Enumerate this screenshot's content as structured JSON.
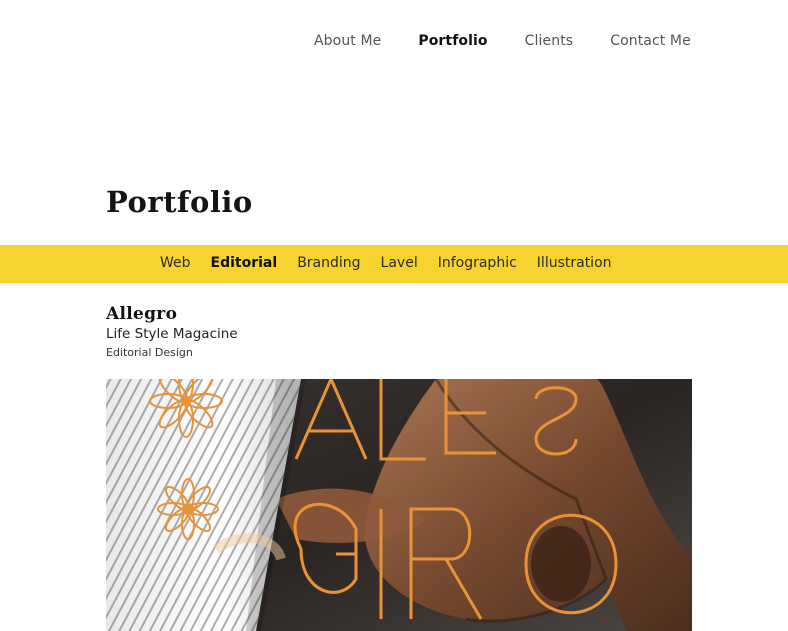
{
  "nav": {
    "items": [
      {
        "label": "About Me",
        "active": false
      },
      {
        "label": "Portfolio",
        "active": true
      },
      {
        "label": "Clients",
        "active": false
      },
      {
        "label": "Contact Me",
        "active": false
      }
    ]
  },
  "page": {
    "title": "Portfolio"
  },
  "categories": {
    "items": [
      {
        "label": "Web",
        "active": false
      },
      {
        "label": "Editorial",
        "active": true
      },
      {
        "label": "Branding",
        "active": false
      },
      {
        "label": "Lavel",
        "active": false
      },
      {
        "label": "Infographic",
        "active": false
      },
      {
        "label": "Illustration",
        "active": false
      }
    ]
  },
  "project": {
    "title": "Allegro",
    "subtitle": "Life Style Magacine",
    "type": "Editorial Design",
    "image_text": "ALLEGRO"
  },
  "colors": {
    "accent": "#f5d430",
    "hero_orange": "#e8923a",
    "text_dark": "#111111"
  }
}
